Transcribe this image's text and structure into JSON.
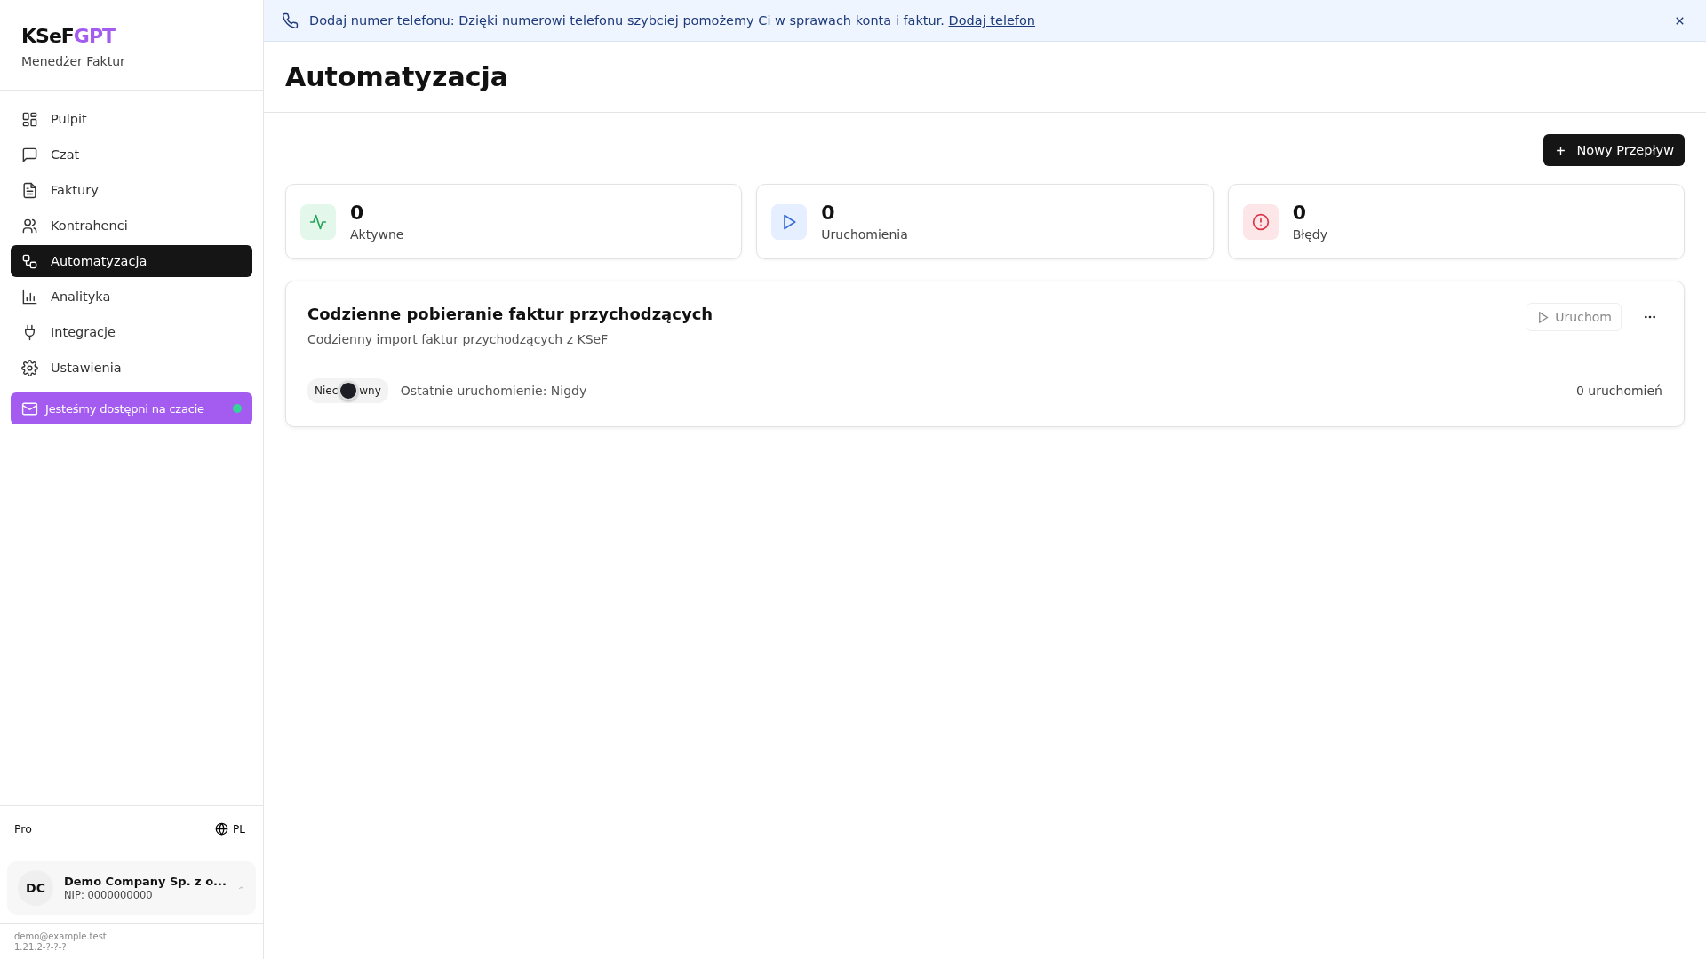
{
  "brand": {
    "name_dark": "KSeF",
    "name_accent": "GPT",
    "subtitle": "Menedżer Faktur"
  },
  "nav": [
    {
      "label": "Pulpit",
      "kind": "grid",
      "selected": false
    },
    {
      "label": "Czat",
      "kind": "chat",
      "selected": false
    },
    {
      "label": "Faktury",
      "kind": "file",
      "selected": false
    },
    {
      "label": "Kontrahenci",
      "kind": "users",
      "selected": false
    },
    {
      "label": "Automatyzacja",
      "kind": "flow",
      "selected": true
    },
    {
      "label": "Analityka",
      "kind": "chart",
      "selected": false
    },
    {
      "label": "Integracje",
      "kind": "plug",
      "selected": false
    },
    {
      "label": "Ustawienia",
      "kind": "gear",
      "selected": false
    }
  ],
  "chat_button": {
    "label": "Jesteśmy dostępni na czacie",
    "online": true
  },
  "plan": "Pro",
  "language": "PL",
  "company": {
    "initials": "DC",
    "name": "Demo Company Sp. z o...",
    "nip": "NIP: 0000000000"
  },
  "footer": {
    "email": "demo@example.test",
    "version": "1.21.2-?-?-?"
  },
  "banner": {
    "text": "Dodaj numer telefonu: Dzięki numerowi telefonu szybciej pomożemy Ci w sprawach konta i faktur.",
    "link": "Dodaj telefon"
  },
  "page_title": "Automatyzacja",
  "new_button": "Nowy Przepływ",
  "stats": [
    {
      "kind": "active",
      "value": "0",
      "label": "Aktywne"
    },
    {
      "kind": "runs",
      "value": "0",
      "label": "Uruchomienia"
    },
    {
      "kind": "errors",
      "value": "0",
      "label": "Błędy"
    }
  ],
  "workflows": [
    {
      "title": "Codzienne pobieranie faktur przychodzących",
      "description": "Codzienny import faktur przychodzących z KSeF",
      "status_before": "Niec",
      "status_after": "wny",
      "on": false,
      "last_run": "Ostatnie uruchomienie: Nigdy",
      "run_count": "0 uruchomień",
      "run_button": "Uruchom"
    }
  ]
}
